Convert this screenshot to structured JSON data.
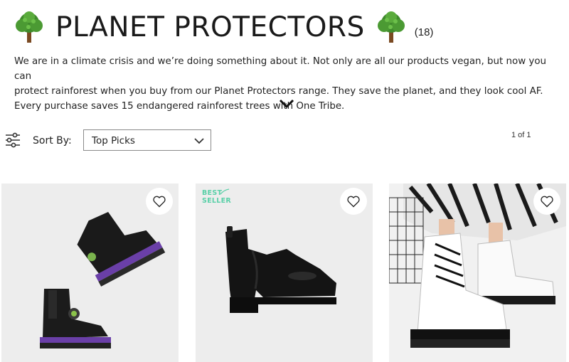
{
  "header": {
    "title": "PLANET PROTECTORS",
    "count": "(18)",
    "icons": [
      "tree-emoji",
      "tree-emoji"
    ]
  },
  "description": {
    "line1": "We are in a climate crisis and we’re doing something about it. Not only are all our products vegan, but now you can",
    "line2": "protect rainforest when you buy from our Planet Protectors range.  They save the planet, and they look cool AF.",
    "line3": "Every purchase saves 15 endangered rainforest trees with One Tribe."
  },
  "toolbar": {
    "sort_label": "Sort By:",
    "sort_value": "Top Picks",
    "pagination": "1 of 1"
  },
  "products": [
    {
      "badge": "",
      "image": "black-platform-chelsea-boots-purple-sole"
    },
    {
      "badge_line1": "BEST",
      "badge_line2": "SELLER",
      "image": "black-chunky-heel-chelsea-boot"
    },
    {
      "badge": "",
      "image": "white-chunky-lace-up-boots"
    }
  ],
  "colors": {
    "accent_green": "#5ad0a8",
    "card_bg": "#ededed",
    "text": "#1f1f1f"
  }
}
